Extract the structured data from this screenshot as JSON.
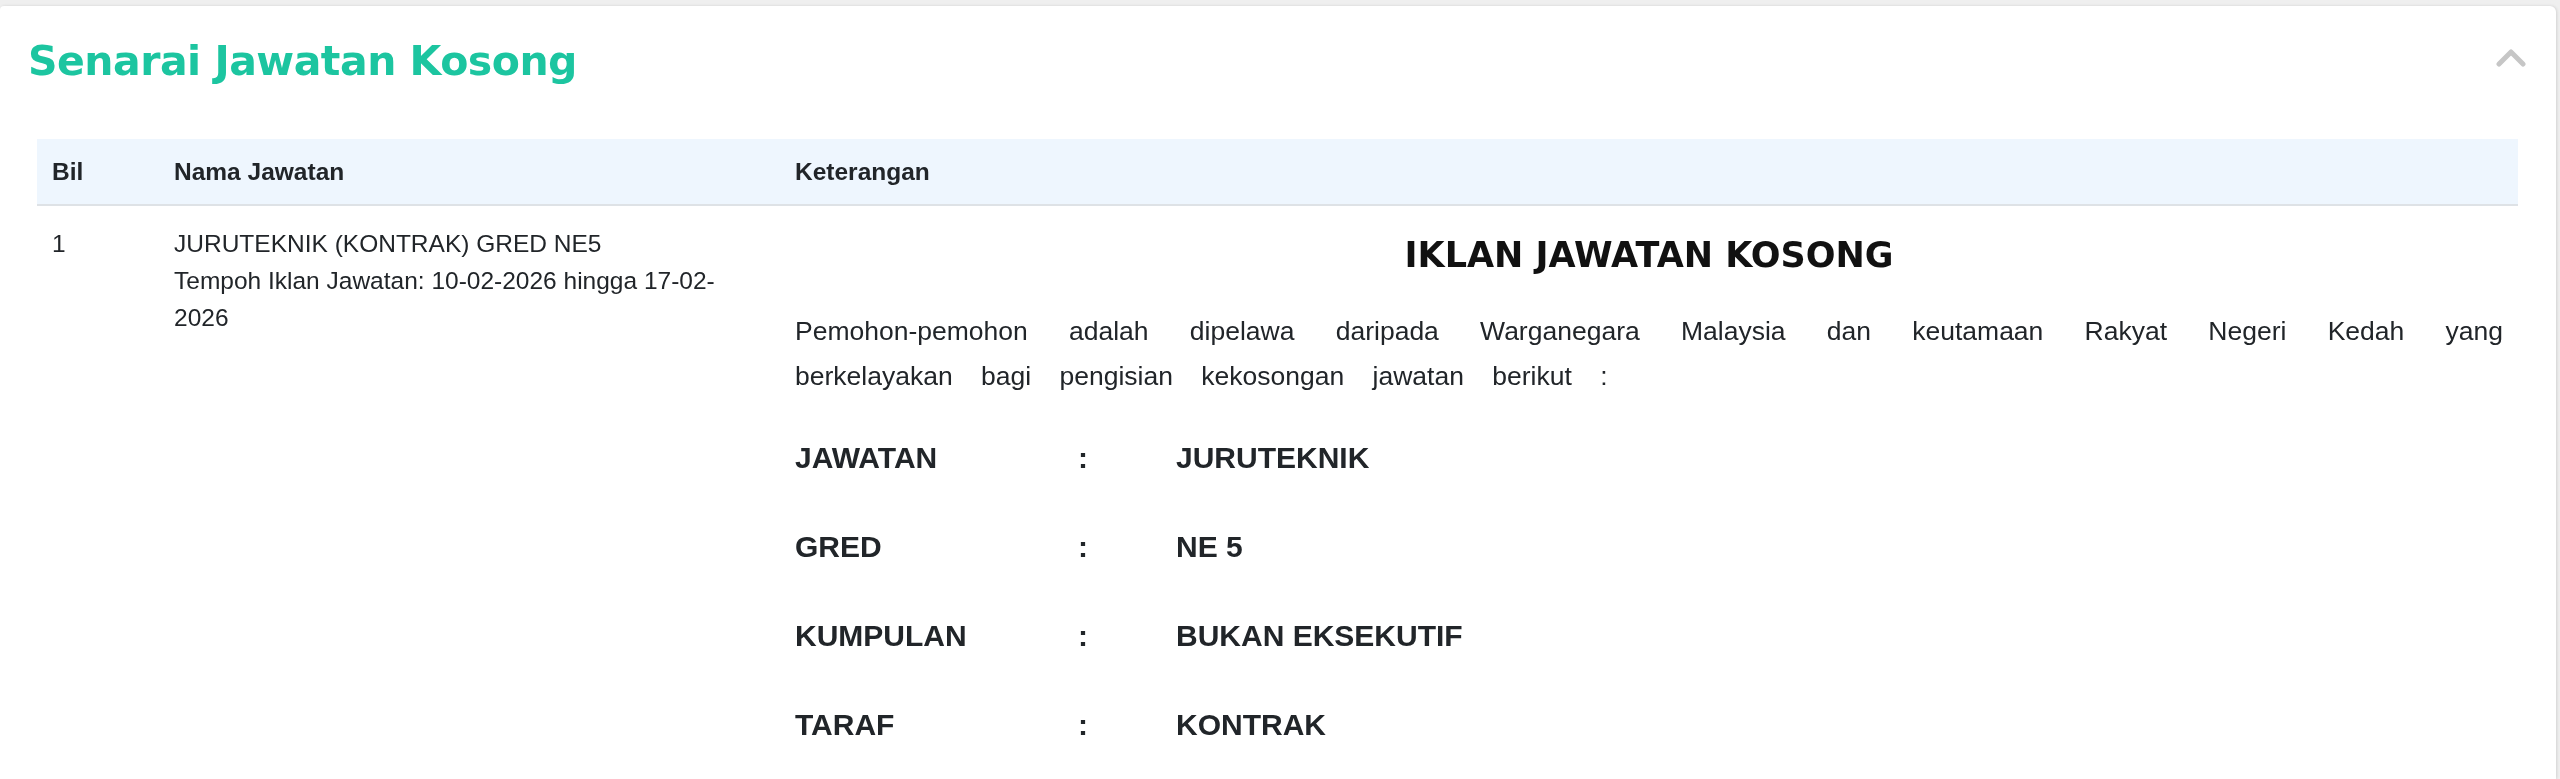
{
  "panel": {
    "title": "Senarai Jawatan Kosong",
    "expanded": true
  },
  "table": {
    "columns": [
      "Bil",
      "Nama Jawatan",
      "Keterangan"
    ],
    "rows": [
      {
        "bil": "1",
        "job_title": "JURUTEKNIK (KONTRAK) GRED NE5",
        "period": "Tempoh Iklan Jawatan: 10-02-2026 hingga 17-02-2026",
        "details": {
          "heading": "IKLAN JAWATAN KOSONG",
          "intro": "Pemohon-pemohon adalah dipelawa daripada Warganegara Malaysia dan keutamaan Rakyat Negeri Kedah yang berkelayakan bagi pengisian kekosongan jawatan berikut :",
          "fields": [
            {
              "label": "JAWATAN",
              "separator": ":",
              "value": "JURUTEKNIK"
            },
            {
              "label": "GRED",
              "separator": ":",
              "value": "NE 5"
            },
            {
              "label": "KUMPULAN",
              "separator": ":",
              "value": "BUKAN EKSEKUTIF"
            },
            {
              "label": "TARAF",
              "separator": ":",
              "value": "KONTRAK"
            }
          ]
        }
      }
    ]
  }
}
